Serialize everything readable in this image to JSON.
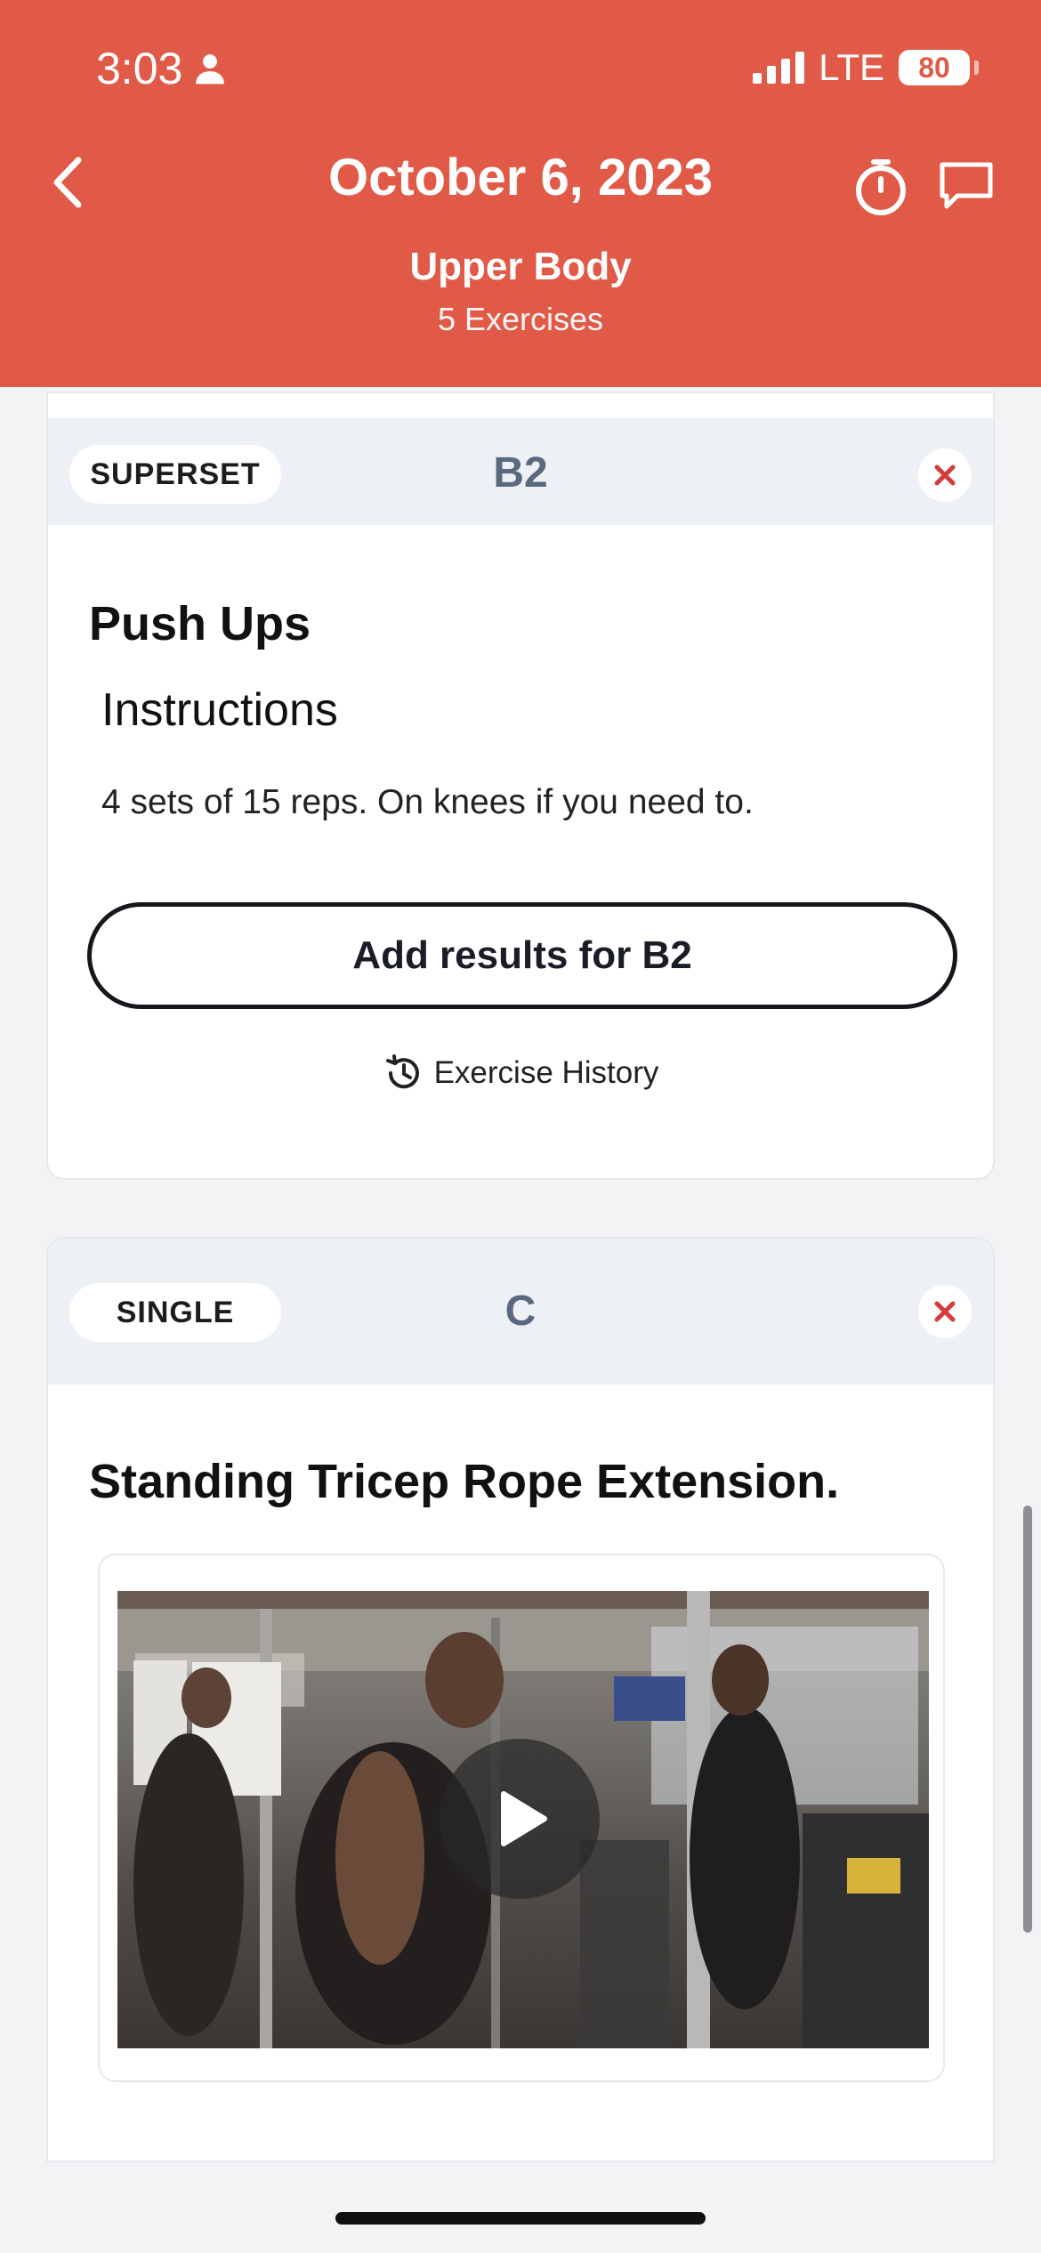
{
  "status": {
    "time": "3:03",
    "network": "LTE",
    "battery": "80"
  },
  "nav": {
    "title": "October 6, 2023",
    "workout": "Upper Body",
    "exercise_count": "5 Exercises"
  },
  "cards": [
    {
      "type_label": "SUPERSET",
      "group": "B2",
      "exercise": "Push Ups",
      "instructions_heading": "Instructions",
      "instructions": "4 sets of 15 reps. On knees if you need to.",
      "results_button": "Add results for B2",
      "history_link": "Exercise History"
    },
    {
      "type_label": "SINGLE",
      "group": "C",
      "exercise": "Standing Tricep Rope Extension."
    }
  ],
  "colors": {
    "header": "#e05a47",
    "close": "#d63a3a",
    "group_label": "#5a6880"
  },
  "icons": [
    "person-icon",
    "signal-icon",
    "back-chevron-icon",
    "stopwatch-icon",
    "chat-icon",
    "close-icon",
    "history-icon",
    "play-icon"
  ]
}
